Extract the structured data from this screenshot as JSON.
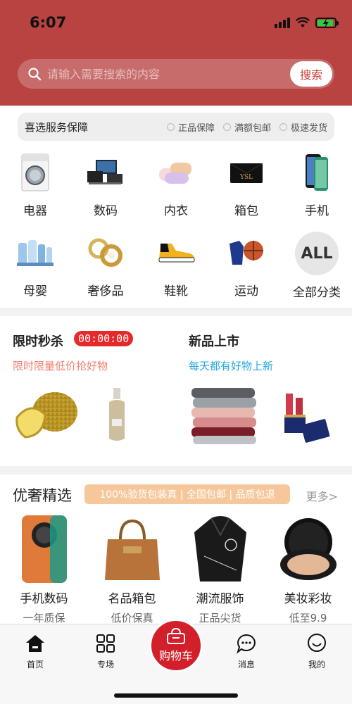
{
  "status": {
    "time": "6:07"
  },
  "search": {
    "placeholder": "请输入需要搜索的内容",
    "button_label": "搜索"
  },
  "guarantee": {
    "title": "喜选服务保障",
    "items": [
      "正品保障",
      "满额包邮",
      "极速发货"
    ]
  },
  "categories": [
    {
      "label": "电器",
      "icon": "washing-machine"
    },
    {
      "label": "数码",
      "icon": "electronics"
    },
    {
      "label": "内衣",
      "icon": "underwear"
    },
    {
      "label": "箱包",
      "icon": "handbag"
    },
    {
      "label": "手机",
      "icon": "smartphone"
    },
    {
      "label": "母婴",
      "icon": "baby-products"
    },
    {
      "label": "奢侈品",
      "icon": "jewelry"
    },
    {
      "label": "鞋靴",
      "icon": "sneaker"
    },
    {
      "label": "运动",
      "icon": "basketball"
    },
    {
      "label": "全部分类",
      "icon": "all",
      "icon_text": "ALL"
    }
  ],
  "flash_sale": {
    "title": "限时秒杀",
    "timer": "00:00:00",
    "subtitle": "限时限量低价抢好物",
    "subtitle_color": "#f08070"
  },
  "new_arrivals": {
    "title": "新品上市",
    "subtitle": "每天都有好物上新",
    "subtitle_color": "#2aa6e0"
  },
  "luxury": {
    "title": "优奢精选",
    "banner": "100%验货包装真 | 全国包邮 | 品质包退",
    "more": "更多>",
    "items": [
      {
        "name": "手机数码",
        "sub": "一年质保"
      },
      {
        "name": "名品箱包",
        "sub": "低价保真"
      },
      {
        "name": "潮流服饰",
        "sub": "正品尖货"
      },
      {
        "name": "美妆彩妆",
        "sub": "低至9.9"
      }
    ]
  },
  "tabs": {
    "home": "首页",
    "special": "专场",
    "cart": "购物车",
    "messages": "消息",
    "mine": "我的"
  },
  "colors": {
    "header": "#b84340",
    "accent": "#d21f2a",
    "timer": "#e8292a"
  }
}
